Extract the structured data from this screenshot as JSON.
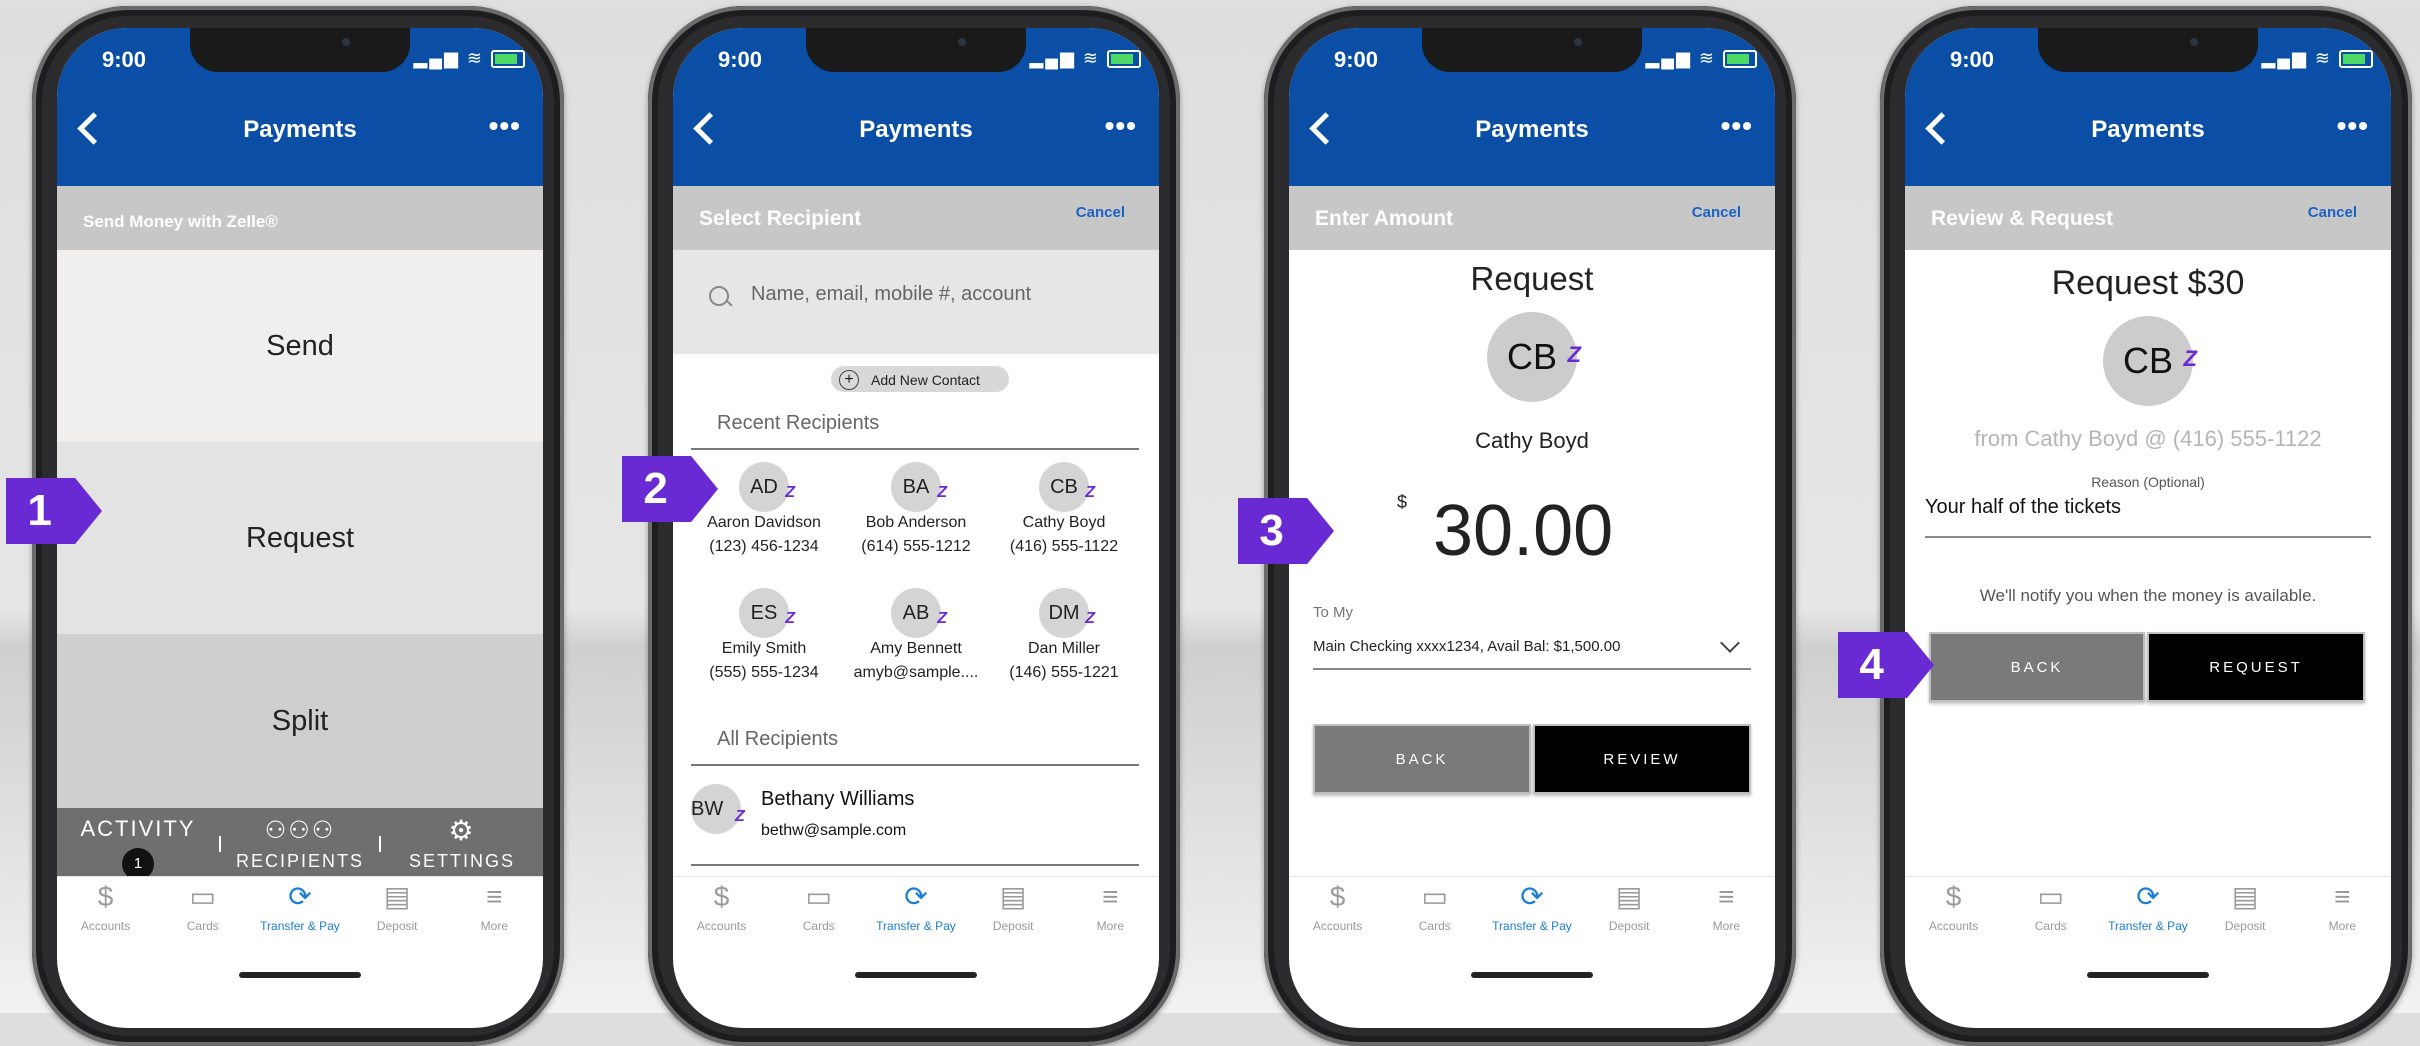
{
  "status": {
    "time": "9:00"
  },
  "header": {
    "title": "Payments",
    "more": "•••"
  },
  "tabs": [
    {
      "label": "Accounts",
      "icon": "dollar-icon",
      "glyph": "$"
    },
    {
      "label": "Cards",
      "icon": "card-icon",
      "glyph": "▭"
    },
    {
      "label": "Transfer & Pay",
      "icon": "transfer-icon",
      "glyph": "⟳"
    },
    {
      "label": "Deposit",
      "icon": "deposit-icon",
      "glyph": "▤"
    },
    {
      "label": "More",
      "icon": "menu-icon",
      "glyph": "≡"
    }
  ],
  "steps": [
    "1",
    "2",
    "3",
    "4"
  ],
  "s1": {
    "subtitle": "Send Money with Zelle®",
    "options": [
      "Send",
      "Request",
      "Split"
    ],
    "bottom": {
      "activity": "ACTIVITY",
      "badge": "1",
      "recipients": "RECIPIENTS",
      "settings": "SETTINGS"
    }
  },
  "s2": {
    "subtitle": "Select Recipient",
    "cancel": "Cancel",
    "search_placeholder": "Name, email, mobile #, account",
    "add_contact": "Add New Contact",
    "recent_header": "Recent Recipients",
    "recent": [
      {
        "initials": "AD",
        "name": "Aaron Davidson",
        "contact": "(123) 456-1234"
      },
      {
        "initials": "BA",
        "name": "Bob Anderson",
        "contact": "(614) 555-1212"
      },
      {
        "initials": "CB",
        "name": "Cathy Boyd",
        "contact": "(416) 555-1122"
      },
      {
        "initials": "ES",
        "name": "Emily Smith",
        "contact": "(555) 555-1234"
      },
      {
        "initials": "AB",
        "name": "Amy Bennett",
        "contact": "amyb@sample...."
      },
      {
        "initials": "DM",
        "name": "Dan Miller",
        "contact": "(146) 555-1221"
      }
    ],
    "all_header": "All Recipients",
    "all": [
      {
        "initials": "BW",
        "name": "Bethany Williams",
        "contact": "bethw@sample.com"
      }
    ]
  },
  "s3": {
    "subtitle": "Enter Amount",
    "cancel": "Cancel",
    "heading": "Request",
    "initials": "CB",
    "name": "Cathy Boyd",
    "currency": "$",
    "amount": "30.00",
    "to_label": "To My",
    "account": "Main Checking xxxx1234, Avail Bal: $1,500.00",
    "back": "BACK",
    "review": "REVIEW"
  },
  "s4": {
    "subtitle": "Review & Request",
    "cancel": "Cancel",
    "heading": "Request $30",
    "initials": "CB",
    "from": "from Cathy Boyd @ (416) 555-1122",
    "reason_label": "Reason (Optional)",
    "reason_value": "Your half of the tickets",
    "notice": "We'll notify you when the money is available.",
    "back": "BACK",
    "request": "REQUEST"
  },
  "colors": {
    "brand_blue": "#0a4ea5",
    "zelle_purple": "#6a2ad3",
    "active_tab": "#1b7fd6"
  }
}
